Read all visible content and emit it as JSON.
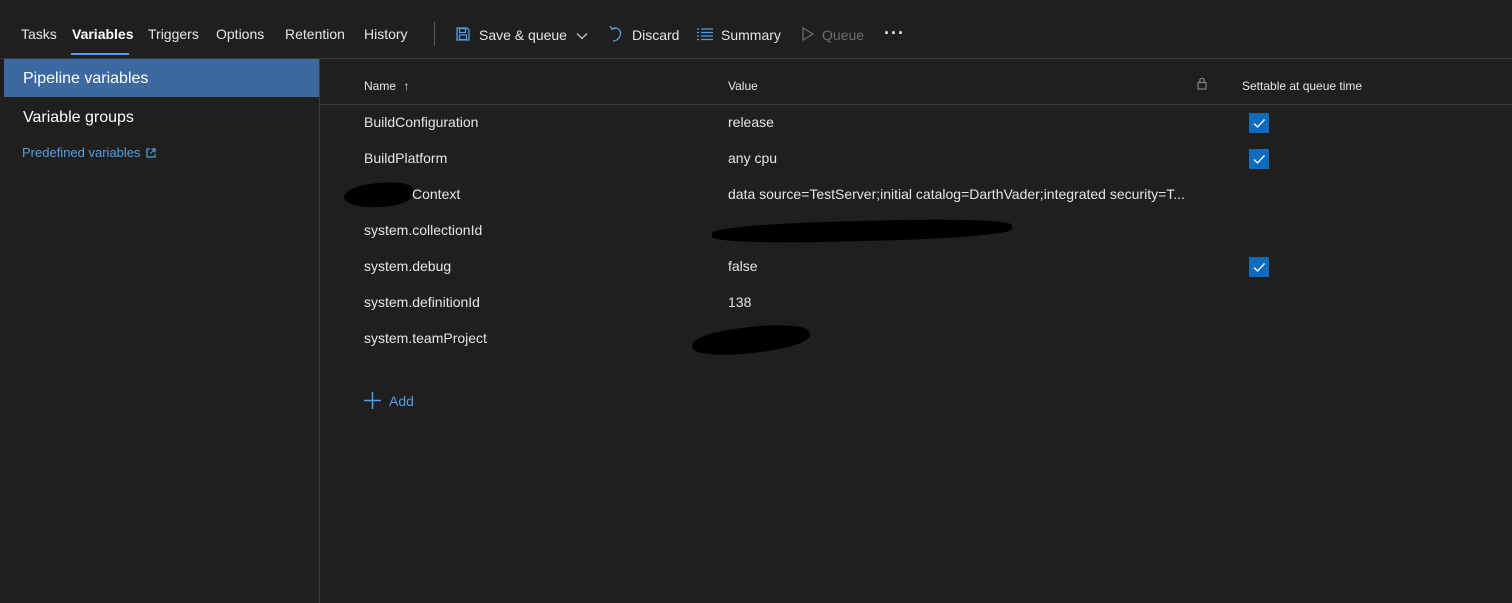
{
  "tabs": [
    {
      "label": "Tasks"
    },
    {
      "label": "Variables"
    },
    {
      "label": "Triggers"
    },
    {
      "label": "Options"
    },
    {
      "label": "Retention"
    },
    {
      "label": "History"
    }
  ],
  "toolbar": {
    "save_queue": "Save & queue",
    "discard": "Discard",
    "summary": "Summary",
    "queue": "Queue",
    "more": "···"
  },
  "leftnav": {
    "pipeline_variables": "Pipeline variables",
    "variable_groups": "Variable groups",
    "predefined_variables": "Predefined variables"
  },
  "grid": {
    "col_name": "Name",
    "sort_indicator": "↑",
    "col_value": "Value",
    "col_settable": "Settable at queue time",
    "rows": [
      {
        "name": "BuildConfiguration",
        "value": "release",
        "settable": true
      },
      {
        "name": "BuildPlatform",
        "value": "any cpu",
        "settable": true
      },
      {
        "name": "Context",
        "value": "data source=TestServer;initial catalog=DarthVader;integrated security=T...",
        "settable": false
      },
      {
        "name": "system.collectionId",
        "value": "",
        "settable": false
      },
      {
        "name": "system.debug",
        "value": "false",
        "settable": true
      },
      {
        "name": "system.definitionId",
        "value": "138",
        "settable": false
      },
      {
        "name": "system.teamProject",
        "value": "",
        "settable": false
      }
    ]
  },
  "add_label": "Add",
  "colors": {
    "accent": "#4f9fe8",
    "selected_nav": "#3c6aa0",
    "checkbox": "#0f6cbd",
    "background": "#201f1e"
  }
}
